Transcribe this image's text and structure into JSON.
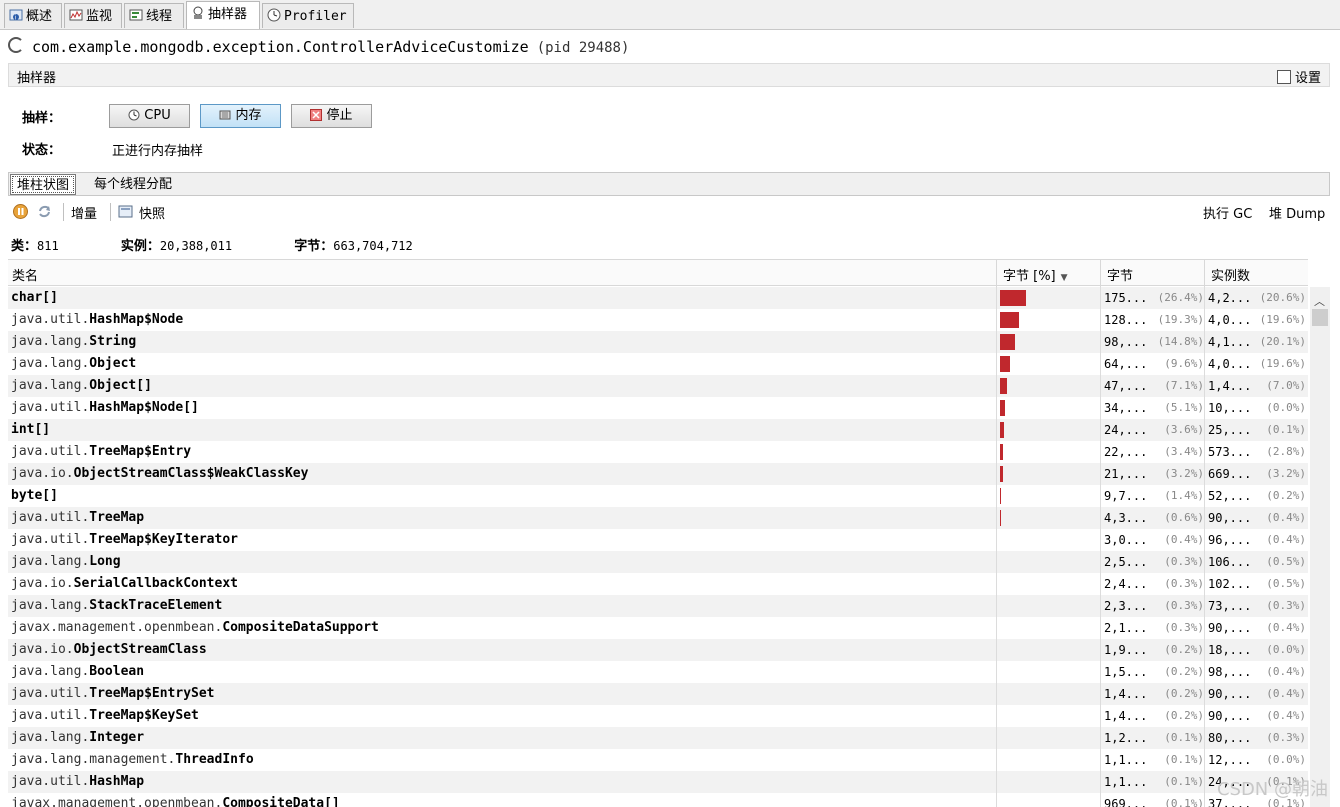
{
  "tabs": [
    {
      "label": "概述",
      "icon": "info-icon"
    },
    {
      "label": "监视",
      "icon": "monitor-chart-icon"
    },
    {
      "label": "线程",
      "icon": "threads-icon"
    },
    {
      "label": "抽样器",
      "icon": "sampler-icon"
    },
    {
      "label": "Profiler",
      "icon": "profiler-clock-icon"
    }
  ],
  "title": {
    "main": "com.example.mongodb.exception.ControllerAdviceCustomize",
    "pid": "(pid 29488)"
  },
  "section": {
    "name": "抽样器",
    "settings_label": "设置"
  },
  "sampling": {
    "label": "抽样：",
    "cpu": "CPU",
    "memory": "内存",
    "stop": "停止",
    "status_label": "状态：",
    "status_value": "正进行内存抽样"
  },
  "subtabs": {
    "histogram": "堆柱状图",
    "per_thread": "每个线程分配"
  },
  "toolbar": {
    "delta": "增量",
    "snapshot": "快照",
    "gc": "执行 GC",
    "heap_dump": "堆 Dump"
  },
  "summary": {
    "classes_label": "类：",
    "classes_value": "811",
    "instances_label": "实例：",
    "instances_value": "20,388,011",
    "bytes_label": "字节：",
    "bytes_value": "663,704,712"
  },
  "table": {
    "headers": {
      "name": "类名",
      "bytes_pct": "字节 [%]",
      "bytes": "字节",
      "instances": "实例数"
    },
    "rows": [
      {
        "pkg": "",
        "cls": "char[]",
        "bar": 26.4,
        "bytes": "175...",
        "bpct": "(26.4%)",
        "inst": "4,2...",
        "ipct": "(20.6%)"
      },
      {
        "pkg": "java.util.",
        "cls": "HashMap$Node",
        "bar": 19.3,
        "bytes": "128...",
        "bpct": "(19.3%)",
        "inst": "4,0...",
        "ipct": "(19.6%)"
      },
      {
        "pkg": "java.lang.",
        "cls": "String",
        "bar": 14.8,
        "bytes": "98,...",
        "bpct": "(14.8%)",
        "inst": "4,1...",
        "ipct": "(20.1%)"
      },
      {
        "pkg": "java.lang.",
        "cls": "Object",
        "bar": 9.6,
        "bytes": "64,...",
        "bpct": "(9.6%)",
        "inst": "4,0...",
        "ipct": "(19.6%)"
      },
      {
        "pkg": "java.lang.",
        "cls": "Object[]",
        "bar": 7.1,
        "bytes": "47,...",
        "bpct": "(7.1%)",
        "inst": "1,4...",
        "ipct": "(7.0%)"
      },
      {
        "pkg": "java.util.",
        "cls": "HashMap$Node[]",
        "bar": 5.1,
        "bytes": "34,...",
        "bpct": "(5.1%)",
        "inst": "10,...",
        "ipct": "(0.0%)"
      },
      {
        "pkg": "",
        "cls": "int[]",
        "bar": 3.6,
        "bytes": "24,...",
        "bpct": "(3.6%)",
        "inst": "25,...",
        "ipct": "(0.1%)"
      },
      {
        "pkg": "java.util.",
        "cls": "TreeMap$Entry",
        "bar": 3.4,
        "bytes": "22,...",
        "bpct": "(3.4%)",
        "inst": "573...",
        "ipct": "(2.8%)"
      },
      {
        "pkg": "java.io.",
        "cls": "ObjectStreamClass$WeakClassKey",
        "bar": 3.2,
        "bytes": "21,...",
        "bpct": "(3.2%)",
        "inst": "669...",
        "ipct": "(3.2%)"
      },
      {
        "pkg": "",
        "cls": "byte[]",
        "bar": 1.4,
        "bytes": "9,7...",
        "bpct": "(1.4%)",
        "inst": "52,...",
        "ipct": "(0.2%)"
      },
      {
        "pkg": "java.util.",
        "cls": "TreeMap",
        "bar": 0.6,
        "bytes": "4,3...",
        "bpct": "(0.6%)",
        "inst": "90,...",
        "ipct": "(0.4%)"
      },
      {
        "pkg": "java.util.",
        "cls": "TreeMap$KeyIterator",
        "bar": 0.4,
        "bytes": "3,0...",
        "bpct": "(0.4%)",
        "inst": "96,...",
        "ipct": "(0.4%)"
      },
      {
        "pkg": "java.lang.",
        "cls": "Long",
        "bar": 0.3,
        "bytes": "2,5...",
        "bpct": "(0.3%)",
        "inst": "106...",
        "ipct": "(0.5%)"
      },
      {
        "pkg": "java.io.",
        "cls": "SerialCallbackContext",
        "bar": 0.3,
        "bytes": "2,4...",
        "bpct": "(0.3%)",
        "inst": "102...",
        "ipct": "(0.5%)"
      },
      {
        "pkg": "java.lang.",
        "cls": "StackTraceElement",
        "bar": 0.3,
        "bytes": "2,3...",
        "bpct": "(0.3%)",
        "inst": "73,...",
        "ipct": "(0.3%)"
      },
      {
        "pkg": "javax.management.openmbean.",
        "cls": "CompositeDataSupport",
        "bar": 0.3,
        "bytes": "2,1...",
        "bpct": "(0.3%)",
        "inst": "90,...",
        "ipct": "(0.4%)"
      },
      {
        "pkg": "java.io.",
        "cls": "ObjectStreamClass",
        "bar": 0.2,
        "bytes": "1,9...",
        "bpct": "(0.2%)",
        "inst": "18,...",
        "ipct": "(0.0%)"
      },
      {
        "pkg": "java.lang.",
        "cls": "Boolean",
        "bar": 0.2,
        "bytes": "1,5...",
        "bpct": "(0.2%)",
        "inst": "98,...",
        "ipct": "(0.4%)"
      },
      {
        "pkg": "java.util.",
        "cls": "TreeMap$EntrySet",
        "bar": 0.2,
        "bytes": "1,4...",
        "bpct": "(0.2%)",
        "inst": "90,...",
        "ipct": "(0.4%)"
      },
      {
        "pkg": "java.util.",
        "cls": "TreeMap$KeySet",
        "bar": 0.2,
        "bytes": "1,4...",
        "bpct": "(0.2%)",
        "inst": "90,...",
        "ipct": "(0.4%)"
      },
      {
        "pkg": "java.lang.",
        "cls": "Integer",
        "bar": 0.1,
        "bytes": "1,2...",
        "bpct": "(0.1%)",
        "inst": "80,...",
        "ipct": "(0.3%)"
      },
      {
        "pkg": "java.lang.management.",
        "cls": "ThreadInfo",
        "bar": 0.1,
        "bytes": "1,1...",
        "bpct": "(0.1%)",
        "inst": "12,...",
        "ipct": "(0.0%)"
      },
      {
        "pkg": "java.util.",
        "cls": "HashMap",
        "bar": 0.1,
        "bytes": "1,1...",
        "bpct": "(0.1%)",
        "inst": "24,...",
        "ipct": "(0.1%)"
      },
      {
        "pkg": "javax.management.openmbean.",
        "cls": "CompositeData[]",
        "bar": 0.1,
        "bytes": "969...",
        "bpct": "(0.1%)",
        "inst": "37,...",
        "ipct": "(0.1%)"
      }
    ]
  },
  "watermark": "CSDN @朝油",
  "colors": {
    "bar": "#c0282d",
    "row_alt": "#f2f2f2",
    "selected_button": "#c2e1f6"
  }
}
